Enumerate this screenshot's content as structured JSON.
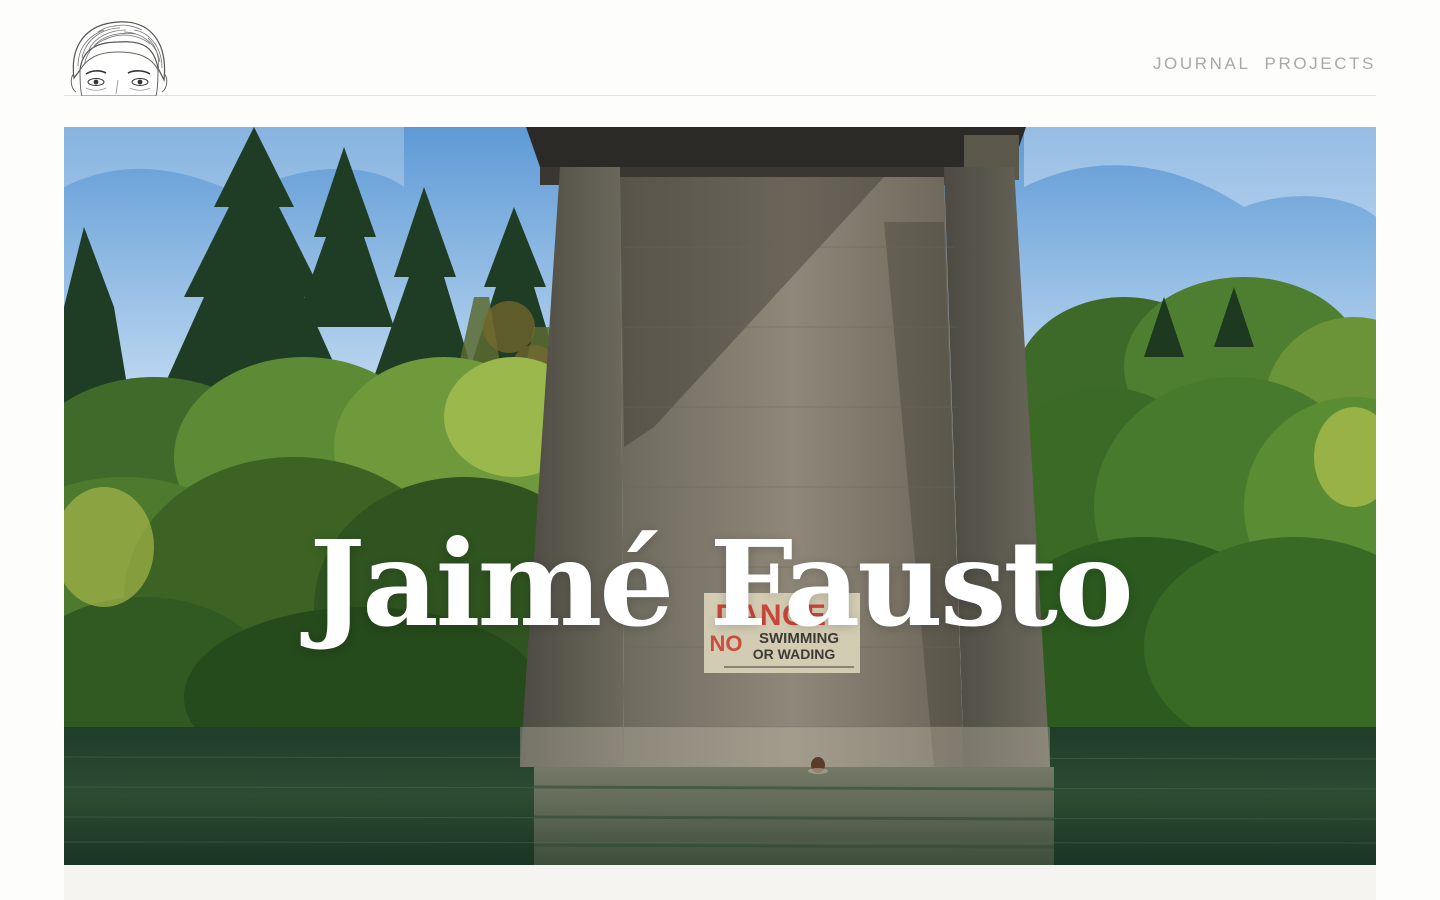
{
  "header": {
    "avatar_alt": "hand-drawn portrait illustration",
    "nav": [
      {
        "label": "JOURNAL"
      },
      {
        "label": "PROJECTS"
      }
    ]
  },
  "hero": {
    "title": "Jaimé Fausto",
    "image_description": "concrete bridge pier standing in a river surrounded by redwood and green trees; a swimmer's head is visible in the water",
    "sign": {
      "line1": "DANGER",
      "line2": "NO",
      "line3": "SWIMMING",
      "line4": "OR WADING"
    }
  },
  "colors": {
    "background": "#fdfdfb",
    "nav_text": "#a9a9a6",
    "title_text": "#ffffff",
    "divider": "#e4e4e2",
    "strip": "#f5f4f0"
  }
}
